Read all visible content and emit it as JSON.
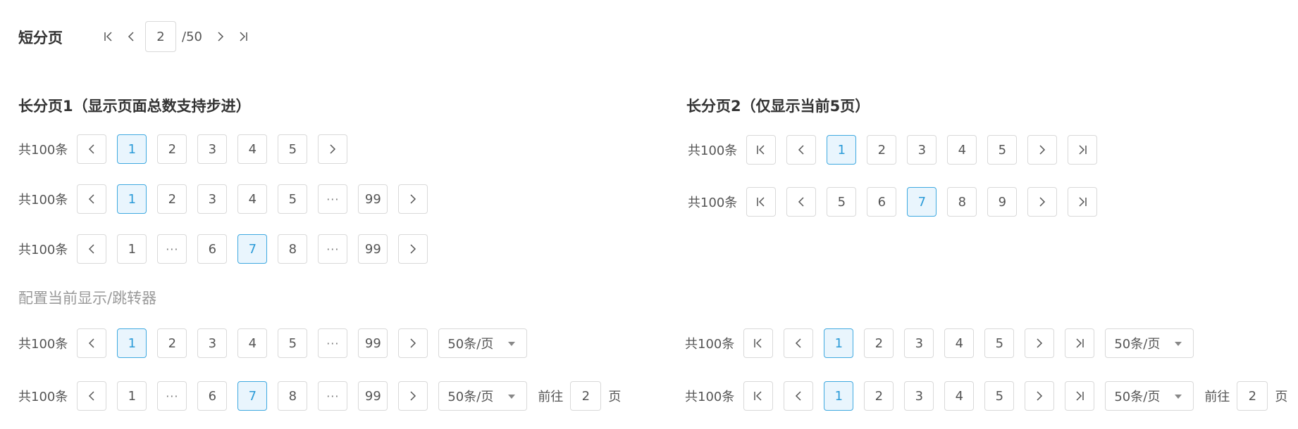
{
  "headings": {
    "short": "短分页",
    "long1": "长分页1（显示页面总数支持步进）",
    "long2": "长分页2（仅显示当前5页）",
    "config": "配置当前显示/跳转器"
  },
  "short_pager": {
    "current": "2",
    "total": "/50"
  },
  "total_text": "共100条",
  "size_select": "50条/页",
  "jump": {
    "label": "前往",
    "value": "2",
    "unit": "页"
  },
  "ellipsis": "···",
  "colors": {
    "active_border": "#3fa9e0",
    "active_bg": "#e9f5fd",
    "active_text": "#2b9bd8",
    "border": "#d9d9d9"
  },
  "icons": [
    "first-page-icon",
    "prev-page-icon",
    "next-page-icon",
    "last-page-icon",
    "caret-down-icon"
  ],
  "rows": [
    {
      "id": "l1a",
      "total": true,
      "first_last": false,
      "pages": [
        "1",
        "2",
        "3",
        "4",
        "5"
      ],
      "active": "1",
      "sizer": false,
      "jump": false
    },
    {
      "id": "l1b",
      "total": true,
      "first_last": false,
      "pages": [
        "1",
        "2",
        "3",
        "4",
        "5",
        "···",
        "99"
      ],
      "active": "1",
      "sizer": false,
      "jump": false
    },
    {
      "id": "l1c",
      "total": true,
      "first_last": false,
      "pages": [
        "1",
        "···",
        "6",
        "7",
        "8",
        "···",
        "99"
      ],
      "active": "7",
      "sizer": false,
      "jump": false
    },
    {
      "id": "l2a",
      "total": true,
      "first_last": true,
      "pages": [
        "1",
        "2",
        "3",
        "4",
        "5"
      ],
      "active": "1",
      "sizer": false,
      "jump": false
    },
    {
      "id": "l2b",
      "total": true,
      "first_last": true,
      "pages": [
        "5",
        "6",
        "7",
        "8",
        "9"
      ],
      "active": "7",
      "sizer": false,
      "jump": false
    },
    {
      "id": "c1",
      "total": true,
      "first_last": false,
      "pages": [
        "1",
        "2",
        "3",
        "4",
        "5",
        "···",
        "99"
      ],
      "active": "1",
      "sizer": true,
      "jump": false
    },
    {
      "id": "c2",
      "total": true,
      "first_last": false,
      "pages": [
        "1",
        "···",
        "6",
        "7",
        "8",
        "···",
        "99"
      ],
      "active": "7",
      "sizer": true,
      "jump": true
    },
    {
      "id": "c3",
      "total": true,
      "first_last": true,
      "pages": [
        "1",
        "2",
        "3",
        "4",
        "5"
      ],
      "active": "1",
      "sizer": true,
      "jump": false
    },
    {
      "id": "c4",
      "total": true,
      "first_last": true,
      "pages": [
        "1",
        "2",
        "3",
        "4",
        "5"
      ],
      "active": "1",
      "sizer": true,
      "jump": true
    }
  ]
}
